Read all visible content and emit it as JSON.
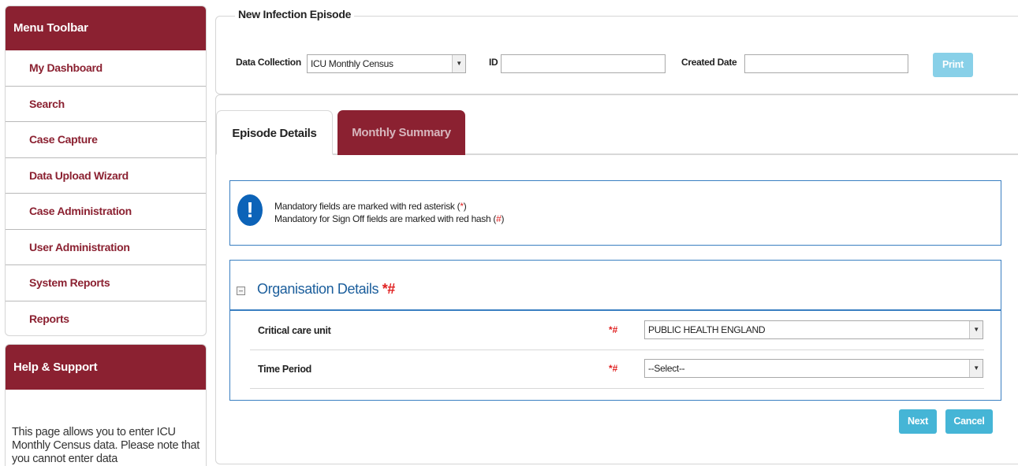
{
  "sidebar": {
    "title": "Menu Toolbar",
    "items": [
      {
        "label": "My Dashboard"
      },
      {
        "label": "Search"
      },
      {
        "label": "Case Capture"
      },
      {
        "label": "Data Upload Wizard"
      },
      {
        "label": "Case Administration"
      },
      {
        "label": "User Administration"
      },
      {
        "label": "System Reports"
      },
      {
        "label": "Reports"
      }
    ]
  },
  "help": {
    "title": "Help & Support",
    "text": "This page allows you to enter ICU Monthly Census data. Please note that you cannot enter data"
  },
  "episode": {
    "legend": "New Infection Episode",
    "data_collection_label": "Data Collection",
    "data_collection_value": "ICU Monthly Census",
    "id_label": "ID",
    "id_value": "",
    "created_date_label": "Created Date",
    "created_date_value": "",
    "print_label": "Print"
  },
  "tabs": [
    {
      "label": "Episode Details",
      "active": true
    },
    {
      "label": "Monthly Summary",
      "active": false
    }
  ],
  "info": {
    "icon": "exclamation-icon",
    "line1_prefix": "Mandatory fields are marked with red asterisk (",
    "line1_mark": "*",
    "line1_suffix": ")",
    "line2_prefix": "Mandatory for Sign Off fields are marked with red hash (",
    "line2_mark": "#",
    "line2_suffix": ")"
  },
  "organisation": {
    "title": "Organisation Details",
    "title_mark": "*#",
    "fields": [
      {
        "label": "Critical care unit",
        "mark": "*#",
        "value": "PUBLIC HEALTH ENGLAND"
      },
      {
        "label": "Time Period",
        "mark": "*#",
        "value": "--Select--"
      }
    ]
  },
  "actions": {
    "next_label": "Next",
    "cancel_label": "Cancel"
  },
  "colors": {
    "brand": "#8b2131",
    "accent": "#45b5d6",
    "section_border": "#3a7fc1",
    "required": "#e02020"
  }
}
